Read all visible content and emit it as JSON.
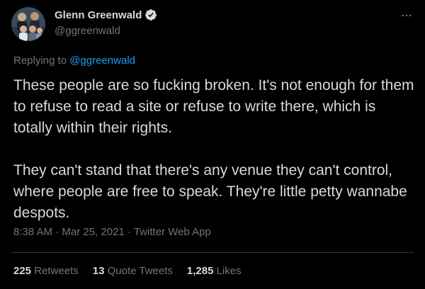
{
  "author": {
    "display_name": "Glenn Greenwald",
    "handle": "@ggreenwald"
  },
  "reply": {
    "prefix": "Replying to",
    "target": "@ggreenwald"
  },
  "tweet": {
    "paragraph1": "These people are so fucking broken. It's not enough for them to refuse to read a site or refuse to write there, which is totally within their rights.",
    "paragraph2": "They can't stand that there's any venue they can't control, where people are free to speak. They're little petty wannabe despots."
  },
  "meta": {
    "time": "8:38 AM",
    "date": "Mar 25, 2021",
    "source": "Twitter Web App",
    "separator": "·"
  },
  "stats": {
    "retweets_count": "225",
    "retweets_label": "Retweets",
    "quotes_count": "13",
    "quotes_label": "Quote Tweets",
    "likes_count": "1,285",
    "likes_label": "Likes"
  },
  "icons": {
    "verified": "verified-badge-icon",
    "more": "more-horizontal-icon"
  },
  "colors": {
    "background": "#000000",
    "text": "#d9d9d9",
    "secondary": "#6e767d",
    "link": "#1d9bf0",
    "divider": "#2f3336"
  }
}
